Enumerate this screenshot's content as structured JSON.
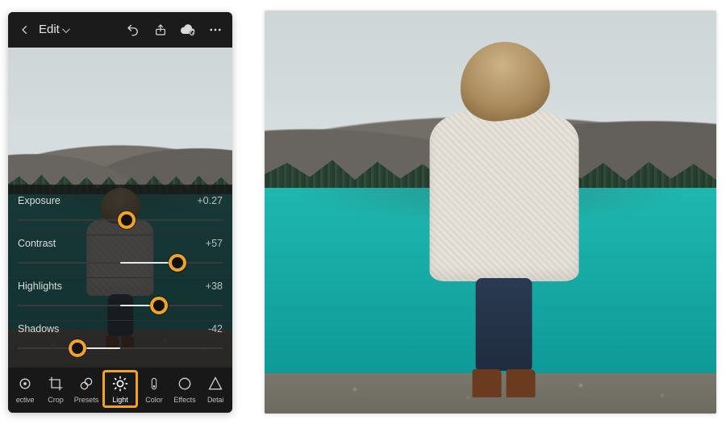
{
  "topbar": {
    "back_label": "Edit"
  },
  "sliders": {
    "exposure": {
      "label": "Exposure",
      "value": "+0.27",
      "percent": 53
    },
    "contrast": {
      "label": "Contrast",
      "value": "+57",
      "percent": 78
    },
    "highlights": {
      "label": "Highlights",
      "value": "+38",
      "percent": 69
    },
    "shadows": {
      "label": "Shadows",
      "value": "-42",
      "percent": 29
    }
  },
  "toolbar": {
    "selective": "ective",
    "crop": "Crop",
    "presets": "Presets",
    "light": "Light",
    "color": "Color",
    "effects": "Effects",
    "detail": "Detai"
  },
  "colors": {
    "accent": "#f2a325"
  }
}
